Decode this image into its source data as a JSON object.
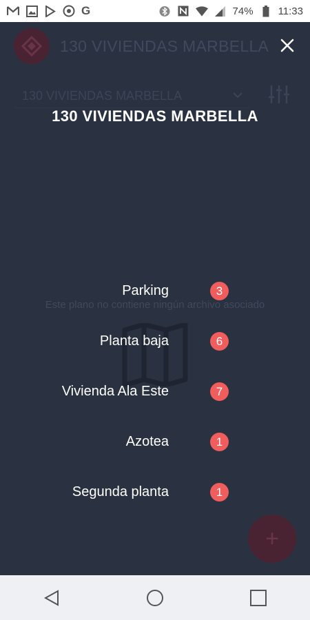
{
  "status_bar": {
    "time": "11:33",
    "battery": "74%",
    "left_icons": [
      "gmail-icon",
      "image-icon",
      "play-store-icon",
      "camera-icon",
      "google-icon"
    ],
    "right_icons": [
      "bluetooth-icon",
      "nfc-icon",
      "wifi-icon",
      "signal-icon",
      "battery-icon"
    ]
  },
  "app": {
    "title": "130 VIVIENDAS MARBELLA",
    "selected_plan": "130 VIVIENDAS MARBELLA",
    "empty_message": "Este plano no contiene ningún archivo asociado",
    "fab_label": "+"
  },
  "overlay": {
    "title": "130 VIVIENDAS MARBELLA",
    "floors": [
      {
        "label": "Parking",
        "count": "3"
      },
      {
        "label": "Planta baja",
        "count": "6"
      },
      {
        "label": "Vivienda Ala Este",
        "count": "7"
      },
      {
        "label": "Azotea",
        "count": "1"
      },
      {
        "label": "Segunda planta",
        "count": "1"
      }
    ]
  },
  "colors": {
    "background": "#2a3140",
    "badge": "#ef5d5d",
    "accent": "#4a2332"
  }
}
